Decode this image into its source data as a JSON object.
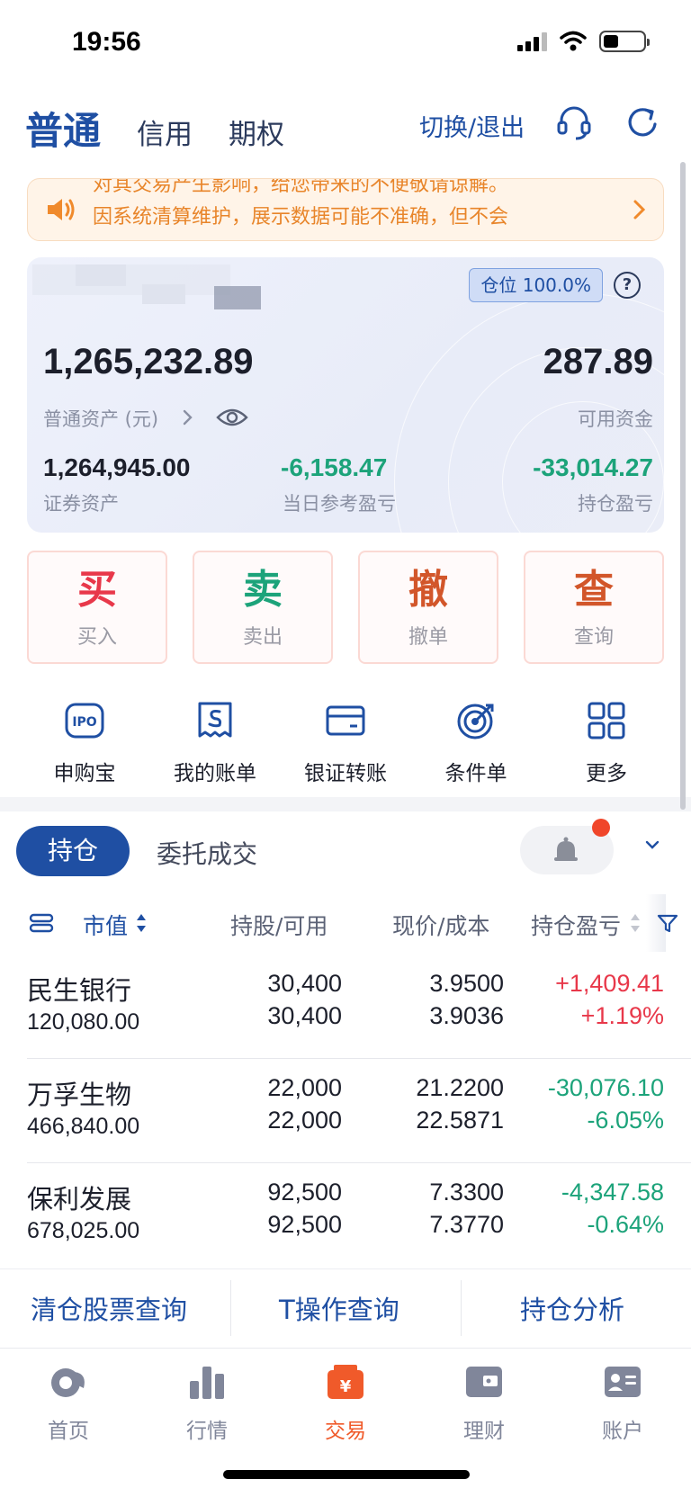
{
  "status_bar": {
    "time": "19:56"
  },
  "header": {
    "tabs": [
      {
        "label": "普通",
        "active": true
      },
      {
        "label": "信用",
        "active": false
      },
      {
        "label": "期权",
        "active": false
      }
    ],
    "switch_exit": "切换/退出",
    "icons": [
      "headset-icon",
      "refresh-icon"
    ]
  },
  "notice": {
    "line1": "对其交易产生影响，给您带来的不便敬请谅解。",
    "line2": "因系统清算维护，展示数据可能不准确，但不会"
  },
  "asset_card": {
    "position_badge": "仓位 100.0%",
    "total_assets": "1,265,232.89",
    "total_assets_label": "普通资产 (元)",
    "available_funds": "287.89",
    "available_funds_label": "可用资金",
    "securities_assets": "1,264,945.00",
    "securities_assets_label": "证券资产",
    "daily_pnl": "-6,158.47",
    "daily_pnl_label": "当日参考盈亏",
    "position_pnl": "-33,014.27",
    "position_pnl_label": "持仓盈亏"
  },
  "actions": [
    {
      "big": "买",
      "small": "买入",
      "color": "#e8384a"
    },
    {
      "big": "卖",
      "small": "卖出",
      "color": "#1ca37a"
    },
    {
      "big": "撤",
      "small": "撤单",
      "color": "#d2562a"
    },
    {
      "big": "查",
      "small": "查询",
      "color": "#d2562a"
    }
  ],
  "quick_menu": [
    {
      "label": "申购宝",
      "icon": "ipo-icon"
    },
    {
      "label": "我的账单",
      "icon": "bill-icon"
    },
    {
      "label": "银证转账",
      "icon": "card-icon"
    },
    {
      "label": "条件单",
      "icon": "target-icon"
    },
    {
      "label": "更多",
      "icon": "grid-icon"
    }
  ],
  "positions_tabs": {
    "active": "持仓",
    "inactive": "委托成交"
  },
  "table": {
    "headers": {
      "market_value": "市值",
      "shares": "持股/可用",
      "price": "现价/成本",
      "pnl": "持仓盈亏"
    },
    "rows": [
      {
        "name": "民生银行",
        "market_value": "120,080.00",
        "shares": "30,400",
        "available": "30,400",
        "price": "3.9500",
        "cost": "3.9036",
        "pnl": "+1,409.41",
        "pnl_pct": "+1.19%",
        "trend": "up"
      },
      {
        "name": "万孚生物",
        "market_value": "466,840.00",
        "shares": "22,000",
        "available": "22,000",
        "price": "21.2200",
        "cost": "22.5871",
        "pnl": "-30,076.10",
        "pnl_pct": "-6.05%",
        "trend": "down"
      },
      {
        "name": "保利发展",
        "market_value": "678,025.00",
        "shares": "92,500",
        "available": "92,500",
        "price": "7.3300",
        "cost": "7.3770",
        "pnl": "-4,347.58",
        "pnl_pct": "-0.64%",
        "trend": "down"
      }
    ]
  },
  "bottom_links": [
    "清仓股票查询",
    "T操作查询",
    "持仓分析"
  ],
  "tabbar": [
    {
      "label": "首页",
      "active": false
    },
    {
      "label": "行情",
      "active": false
    },
    {
      "label": "交易",
      "active": true
    },
    {
      "label": "理财",
      "active": false
    },
    {
      "label": "账户",
      "active": false
    }
  ],
  "colors": {
    "brand": "#1f4fa3",
    "up": "#e8384a",
    "down": "#1ca37a",
    "accent": "#f05a2a"
  }
}
